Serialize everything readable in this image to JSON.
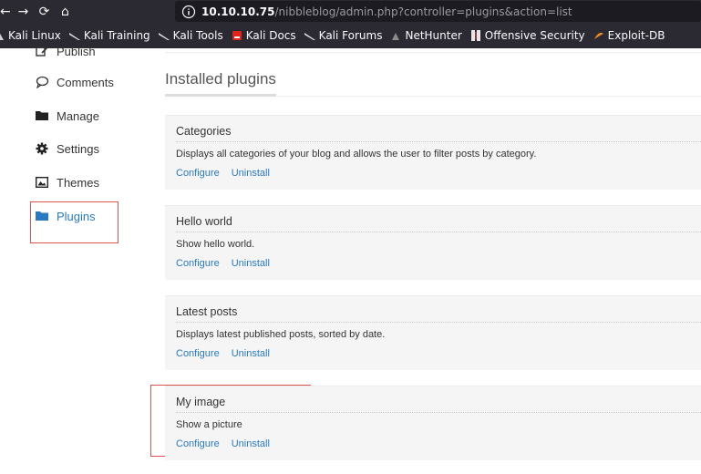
{
  "browser": {
    "nav": {
      "back": "←",
      "forward": "→",
      "reload": "⟳",
      "home": "⌂"
    },
    "url": {
      "host": "10.10.10.75",
      "path": "/nibbleblog/admin.php?controller=plugins&action=list"
    },
    "bookmarks": [
      {
        "label": "Kali Linux",
        "icon": "kali-dragon-icon"
      },
      {
        "label": "Kali Training",
        "icon": "kali-dragon-icon"
      },
      {
        "label": "Kali Tools",
        "icon": "kali-dragon-icon"
      },
      {
        "label": "Kali Docs",
        "icon": "kali-docs-icon"
      },
      {
        "label": "Kali Forums",
        "icon": "kali-dragon-icon"
      },
      {
        "label": "NetHunter",
        "icon": "nethunter-icon"
      },
      {
        "label": "Offensive Security",
        "icon": "offsec-icon"
      },
      {
        "label": "Exploit-DB",
        "icon": "exploitdb-icon"
      }
    ]
  },
  "sidebar": {
    "items": [
      {
        "label": "Publish",
        "icon": "publish-icon"
      },
      {
        "label": "Comments",
        "icon": "comment-icon"
      },
      {
        "label": "Manage",
        "icon": "folder-icon"
      },
      {
        "label": "Settings",
        "icon": "gear-icon"
      },
      {
        "label": "Themes",
        "icon": "image-icon"
      },
      {
        "label": "Plugins",
        "icon": "folder-icon",
        "active": true
      }
    ]
  },
  "main": {
    "title": "Installed plugins",
    "plugins": [
      {
        "name": "Categories",
        "description": "Displays all categories of your blog and allows the user to filter posts by category.",
        "configure": "Configure",
        "uninstall": "Uninstall"
      },
      {
        "name": "Hello world",
        "description": "Show hello world.",
        "configure": "Configure",
        "uninstall": "Uninstall"
      },
      {
        "name": "Latest posts",
        "description": "Displays latest published posts, sorted by date.",
        "configure": "Configure",
        "uninstall": "Uninstall"
      },
      {
        "name": "My image",
        "description": "Show a picture",
        "configure": "Configure",
        "uninstall": "Uninstall"
      }
    ]
  },
  "colors": {
    "accent": "#2a7ac0",
    "highlight_box": "#d9534f",
    "chrome": "#2b2a33"
  }
}
